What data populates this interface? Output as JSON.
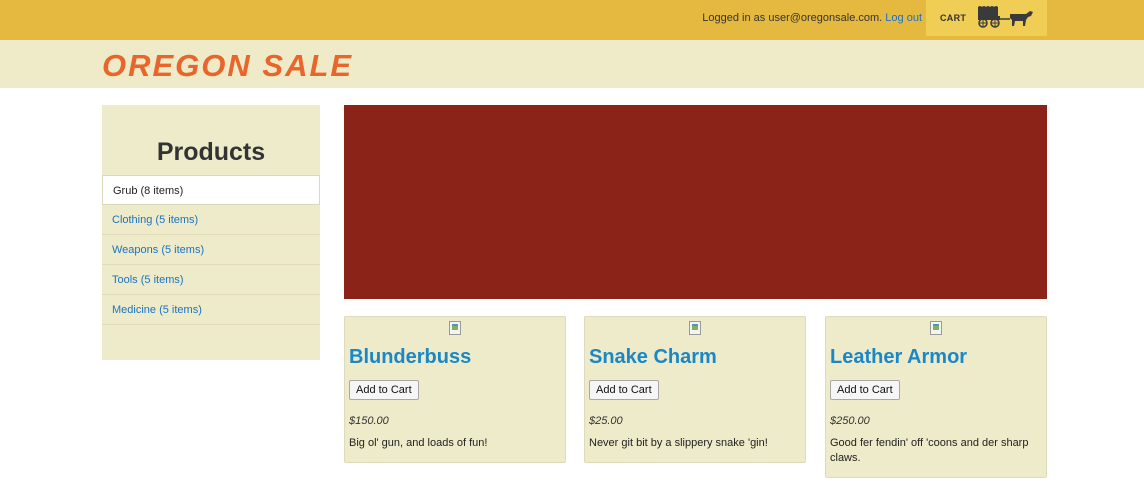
{
  "header": {
    "logged_in_text": "Logged in as user@oregonsale.com.",
    "logout_label": "Log out",
    "cart_label": "CART",
    "cart_icon": "covered-wagon-icon"
  },
  "brand": {
    "name": "OREGON SALE",
    "color": "#e8652b"
  },
  "sidebar": {
    "title": "Products",
    "items": [
      {
        "label": "Grub (8 items)",
        "active": true
      },
      {
        "label": "Clothing (5 items)",
        "active": false
      },
      {
        "label": "Weapons (5 items)",
        "active": false
      },
      {
        "label": "Tools (5 items)",
        "active": false
      },
      {
        "label": "Medicine (5 items)",
        "active": false
      }
    ]
  },
  "banner": {
    "color": "#8b2318"
  },
  "products": [
    {
      "name": "Blunderbuss",
      "button": "Add to Cart",
      "price": "$150.00",
      "description": "Big ol' gun, and loads of fun!",
      "image_icon": "broken-image-icon"
    },
    {
      "name": "Snake Charm",
      "button": "Add to Cart",
      "price": "$25.00",
      "description": "Never git bit by a slippery snake 'gin!",
      "image_icon": "broken-image-icon"
    },
    {
      "name": "Leather Armor",
      "button": "Add to Cart",
      "price": "$250.00",
      "description": "Good fer fendin' off 'coons and der sharp claws.",
      "image_icon": "broken-image-icon"
    }
  ]
}
